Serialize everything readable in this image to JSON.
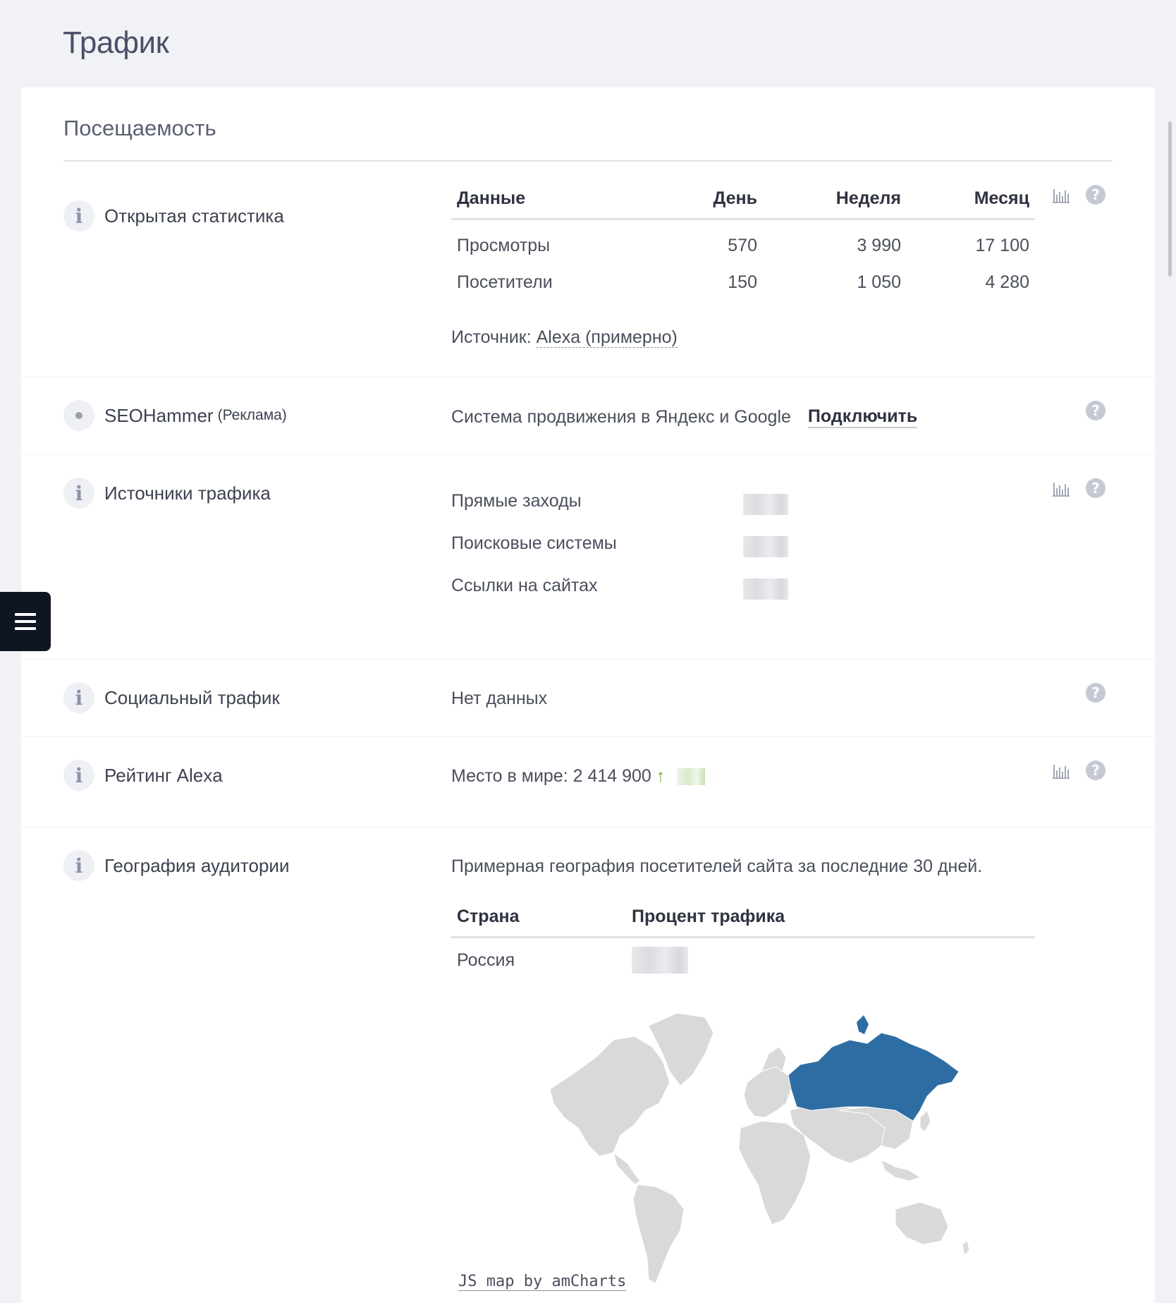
{
  "page": {
    "title": "Трафик"
  },
  "section": {
    "title": "Посещаемость"
  },
  "open_stats": {
    "label": "Открытая статистика",
    "headers": [
      "Данные",
      "День",
      "Неделя",
      "Месяц"
    ],
    "rows": [
      {
        "name": "Просмотры",
        "day": "570",
        "week": "3 990",
        "month": "17 100"
      },
      {
        "name": "Посетители",
        "day": "150",
        "week": "1 050",
        "month": "4 280"
      }
    ],
    "source_prefix": "Источник:",
    "source_link": "Alexa (примерно)"
  },
  "seohammer": {
    "label": "SEOHammer",
    "ad_note": "(Реклама)",
    "description": "Система продвижения в Яндекс и Google",
    "connect_label": "Подключить"
  },
  "traffic_sources": {
    "label": "Источники трафика",
    "items": [
      "Прямые заходы",
      "Поисковые системы",
      "Ссылки на сайтах"
    ]
  },
  "social": {
    "label": "Социальный трафик",
    "value": "Нет данных"
  },
  "alexa": {
    "label": "Рейтинг Alexa",
    "rank_text": "Место в мире: 2 414 900",
    "arrow": "↑"
  },
  "geo": {
    "label": "География аудитории",
    "description": "Примерная география посетителей сайта за последние 30 дней.",
    "headers": [
      "Страна",
      "Процент трафика"
    ],
    "rows": [
      {
        "country": "Россия"
      }
    ],
    "map_highlight_color": "#2e6da4",
    "map_base_color": "#d9d9d9",
    "map_credit": "JS map by amCharts"
  },
  "icons": {
    "info": "i",
    "help": "?"
  }
}
